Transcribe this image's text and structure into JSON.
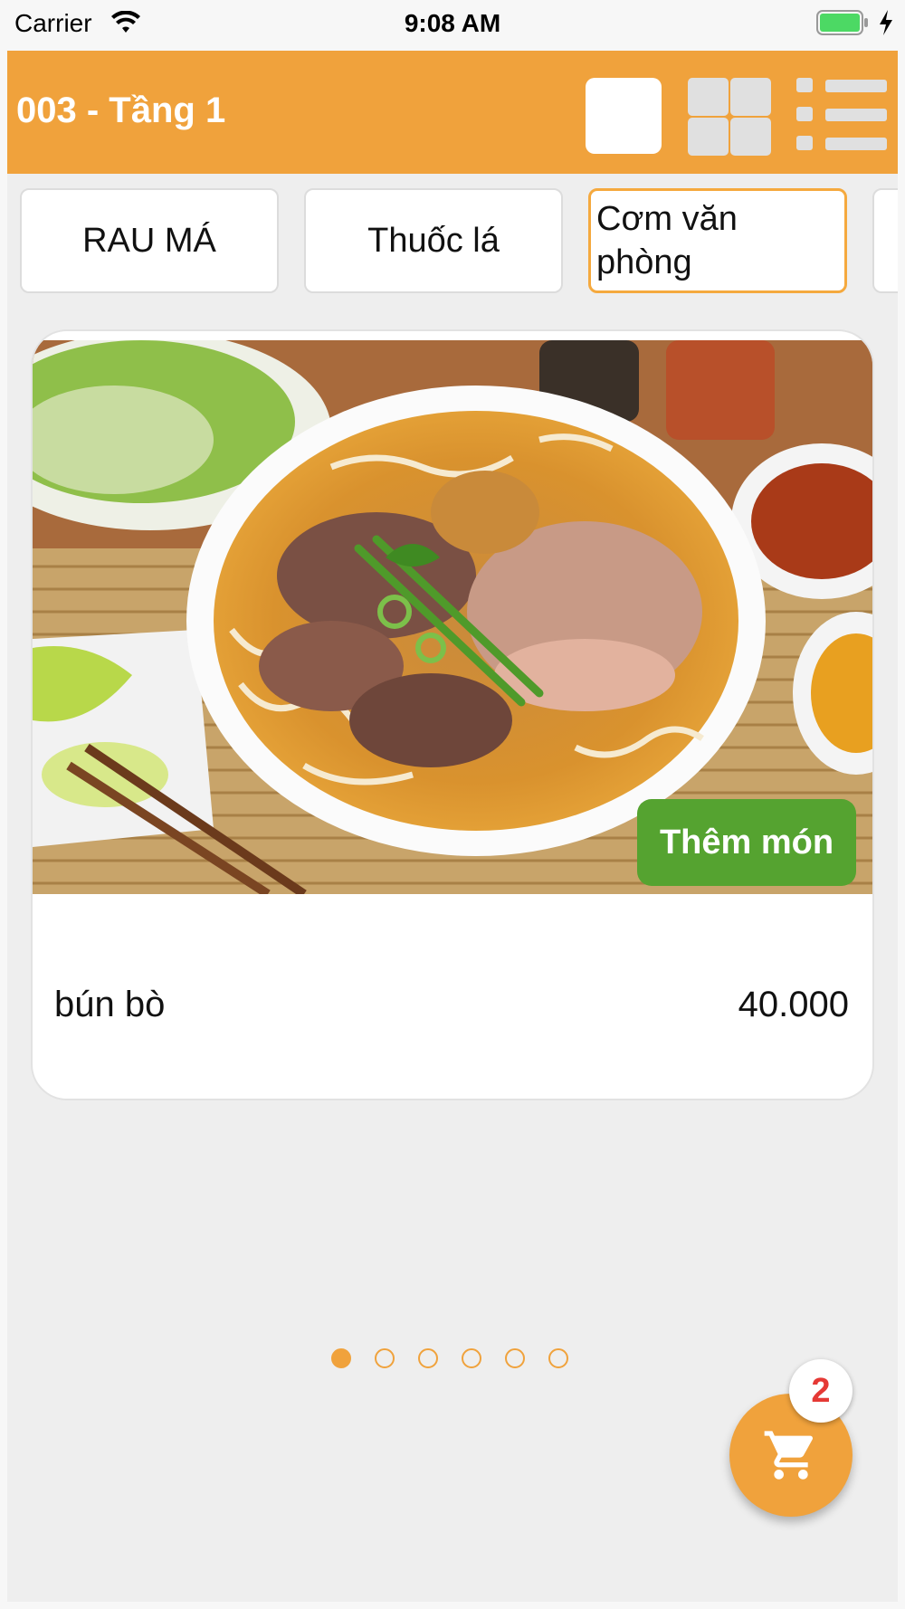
{
  "status_bar": {
    "carrier": "Carrier",
    "time": "9:08 AM"
  },
  "header": {
    "title": "003 - Tầng 1"
  },
  "view_modes": [
    "single-view-icon",
    "grid-view-icon",
    "list-view-icon"
  ],
  "categories": [
    {
      "label": "RAU MÁ",
      "active": false
    },
    {
      "label": "Thuốc lá",
      "active": false
    },
    {
      "label": "Cơm văn phòng",
      "active": true
    }
  ],
  "product": {
    "name": "bún bò",
    "price": "40.000",
    "add_label": "Thêm món"
  },
  "pager": {
    "pages": 6,
    "current": 1
  },
  "cart": {
    "count": "2"
  },
  "colors": {
    "accent": "#f0a23c",
    "add_button": "#55a330",
    "badge_text": "#e53935"
  }
}
